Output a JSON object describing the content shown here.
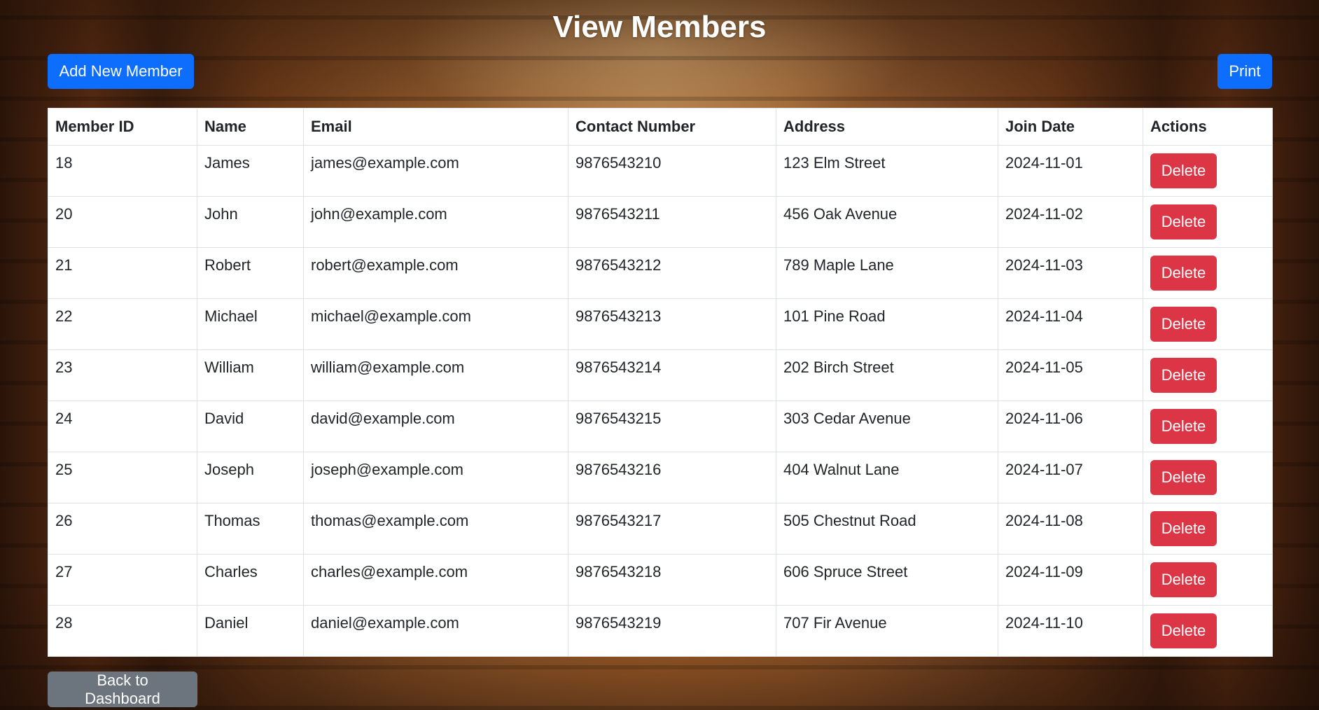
{
  "page": {
    "title": "View Members"
  },
  "toolbar": {
    "add_label": "Add New Member",
    "print_label": "Print"
  },
  "table": {
    "headers": [
      "Member ID",
      "Name",
      "Email",
      "Contact Number",
      "Address",
      "Join Date",
      "Actions"
    ],
    "rows": [
      {
        "id": "18",
        "name": "James",
        "email": "james@example.com",
        "contact": "9876543210",
        "address": "123 Elm Street",
        "join_date": "2024-11-01",
        "action_label": "Delete"
      },
      {
        "id": "20",
        "name": "John",
        "email": "john@example.com",
        "contact": "9876543211",
        "address": "456 Oak Avenue",
        "join_date": "2024-11-02",
        "action_label": "Delete"
      },
      {
        "id": "21",
        "name": "Robert",
        "email": "robert@example.com",
        "contact": "9876543212",
        "address": "789 Maple Lane",
        "join_date": "2024-11-03",
        "action_label": "Delete"
      },
      {
        "id": "22",
        "name": "Michael",
        "email": "michael@example.com",
        "contact": "9876543213",
        "address": "101 Pine Road",
        "join_date": "2024-11-04",
        "action_label": "Delete"
      },
      {
        "id": "23",
        "name": "William",
        "email": "william@example.com",
        "contact": "9876543214",
        "address": "202 Birch Street",
        "join_date": "2024-11-05",
        "action_label": "Delete"
      },
      {
        "id": "24",
        "name": "David",
        "email": "david@example.com",
        "contact": "9876543215",
        "address": "303 Cedar Avenue",
        "join_date": "2024-11-06",
        "action_label": "Delete"
      },
      {
        "id": "25",
        "name": "Joseph",
        "email": "joseph@example.com",
        "contact": "9876543216",
        "address": "404 Walnut Lane",
        "join_date": "2024-11-07",
        "action_label": "Delete"
      },
      {
        "id": "26",
        "name": "Thomas",
        "email": "thomas@example.com",
        "contact": "9876543217",
        "address": "505 Chestnut Road",
        "join_date": "2024-11-08",
        "action_label": "Delete"
      },
      {
        "id": "27",
        "name": "Charles",
        "email": "charles@example.com",
        "contact": "9876543218",
        "address": "606 Spruce Street",
        "join_date": "2024-11-09",
        "action_label": "Delete"
      },
      {
        "id": "28",
        "name": "Daniel",
        "email": "daniel@example.com",
        "contact": "9876543219",
        "address": "707 Fir Avenue",
        "join_date": "2024-11-10",
        "action_label": "Delete"
      }
    ]
  },
  "footer": {
    "back_label": "Back to Dashboard"
  },
  "colors": {
    "primary": "#0d6efd",
    "danger": "#dc3545",
    "secondary": "#6c757d"
  }
}
